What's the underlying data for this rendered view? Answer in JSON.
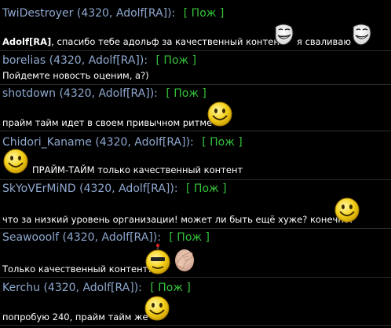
{
  "chat": {
    "messages": [
      {
        "author": "TwiDestroyer",
        "meta": "(4320, Adolf[RA])",
        "colon": ":",
        "rep": "[ Пож ]",
        "addressee": "Adolf[RA]",
        "text_1": ", спасибо тебе адольф за качественный контент",
        "text_2": "я сваливаю",
        "icons": [
          "troll-face-icon",
          "troll-face-icon"
        ]
      },
      {
        "author": "borelias",
        "meta": "(4320, Adolf[RA])",
        "colon": ":",
        "rep": "[ Пож ]",
        "text": "Пойдемте новость оценим, а?)"
      },
      {
        "author": "shotdown",
        "meta": "(4320, Adolf[RA])",
        "colon": ":",
        "rep": "[ Пож ]",
        "text": "прайм тайм идет в своем привычном ритме",
        "icons": [
          "smiley-face-icon"
        ]
      },
      {
        "author": "Chidori_Kaname",
        "meta": "(4320, Adolf[RA])",
        "colon": ":",
        "rep": "[ Пож ]",
        "text": "ПРАЙМ-ТАЙМ только качественный контент",
        "icons": [
          "smiley-face-icon"
        ]
      },
      {
        "author": "SkYoVErMiND",
        "meta": "(4320, Adolf[RA])",
        "colon": ":",
        "rep": "[ Пож ]",
        "text": "что за низкий уровень организации! может ли быть ещё хуже? конечно!",
        "icons": [
          "smiley-face-icon"
        ]
      },
      {
        "author": "Seawooolf",
        "meta": "(4320, Adolf[RA])",
        "colon": ":",
        "rep": "[ Пож ]",
        "text": "Только качественный контент!",
        "icons": [
          "robot-face-icon",
          "facepalm-icon"
        ]
      },
      {
        "author": "Kerchu",
        "meta": "(4320, Adolf[RA])",
        "colon": ":",
        "rep": "[ Пож ]",
        "text": "попробую 240, прайм тайм же",
        "icons": [
          "smiley-face-icon"
        ]
      }
    ]
  },
  "colors": {
    "background": "#000000",
    "author": "#8ea8cf",
    "reputation": "#35c23b",
    "message_text": "#ffffff",
    "separator": "#2b2b2b"
  }
}
